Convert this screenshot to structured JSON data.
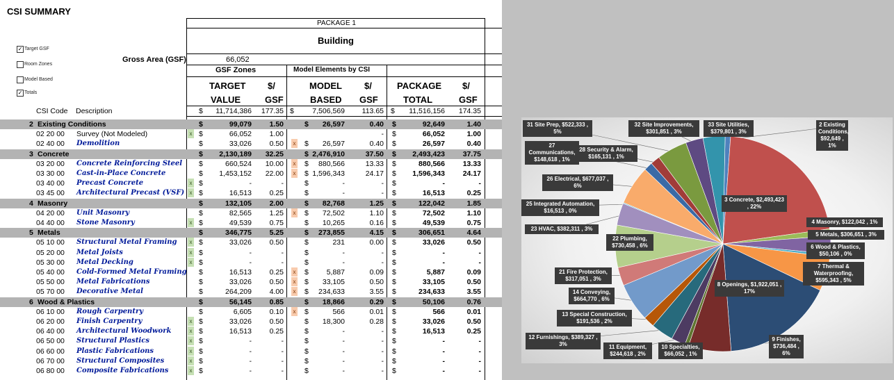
{
  "title": "CSI SUMMARY",
  "checkboxes": [
    {
      "label": "Target GSF",
      "checked": true
    },
    {
      "label": "Room Zones",
      "checked": false
    },
    {
      "label": "Model Based",
      "checked": false
    },
    {
      "label": "Totals",
      "checked": true
    }
  ],
  "package_label": "PACKAGE 1",
  "building_label": "Building",
  "gross_area_label": "Gross Area (GSF)",
  "gross_area_value": "66,052",
  "group_headers": {
    "gsf_zones": "GSF Zones",
    "model_elements": "Model Elements by CSI"
  },
  "col_headers": {
    "target_1": "TARGET",
    "target_2": "VALUE",
    "psf_1": "$/",
    "psf_2": "GSF",
    "model_1": "MODEL",
    "model_2": "BASED",
    "package_1": "PACKAGE",
    "package_2": "TOTAL"
  },
  "code_header": "CSI Code",
  "desc_header": "Description",
  "totals": {
    "dollar": "$",
    "target": "11,714,386",
    "target_psf": "177.35",
    "model": "7,506,569",
    "model_psf": "113.65",
    "package": "11,516,156",
    "package_psf": "174.35"
  },
  "rows": [
    {
      "type": "sec",
      "code": "2",
      "desc": "Existing Conditions",
      "d1": "$",
      "target": "99,079",
      "tpsf": "1.50",
      "d2": "$",
      "model": "26,597",
      "mpsf": "0.40",
      "d3": "$",
      "pkg": "92,649",
      "ppsf": "1.40"
    },
    {
      "type": "item",
      "code": "02 20 00",
      "desc": "Survey (Not Modeled)",
      "style": "plain",
      "g": "x",
      "o": "",
      "d1": "$",
      "target": "66,052",
      "tpsf": "1.00",
      "d2": "",
      "model": "",
      "mpsf": "-",
      "d3": "$",
      "pkg": "66,052",
      "ppsf": "1.00"
    },
    {
      "type": "item",
      "code": "02 40 00",
      "desc": "Demolition",
      "style": "blue",
      "g": "",
      "o": "x",
      "d1": "$",
      "target": "33,026",
      "tpsf": "0.50",
      "d2": "$",
      "model": "26,597",
      "mpsf": "0.40",
      "d3": "$",
      "pkg": "26,597",
      "ppsf": "0.40"
    },
    {
      "type": "sec",
      "code": "3",
      "desc": "Concrete",
      "d1": "$",
      "target": "2,130,189",
      "tpsf": "32.25",
      "d2": "$",
      "model": "2,476,910",
      "mpsf": "37.50",
      "d3": "$",
      "pkg": "2,493,423",
      "ppsf": "37.75"
    },
    {
      "type": "item",
      "code": "03 20 00",
      "desc": "Concrete Reinforcing Steel",
      "style": "blue",
      "g": "",
      "o": "x",
      "d1": "$",
      "target": "660,524",
      "tpsf": "10.00",
      "d2": "$",
      "model": "880,566",
      "mpsf": "13.33",
      "d3": "$",
      "pkg": "880,566",
      "ppsf": "13.33"
    },
    {
      "type": "item",
      "code": "03 30 00",
      "desc": "Cast-in-Place Concrete",
      "style": "blue",
      "g": "",
      "o": "x",
      "d1": "$",
      "target": "1,453,152",
      "tpsf": "22.00",
      "d2": "$",
      "model": "1,596,343",
      "mpsf": "24.17",
      "d3": "$",
      "pkg": "1,596,343",
      "ppsf": "24.17"
    },
    {
      "type": "item",
      "code": "03 40 00",
      "desc": "Precast Concrete",
      "style": "blue",
      "g": "x",
      "o": "",
      "d1": "$",
      "target": "-",
      "tpsf": "-",
      "d2": "$",
      "model": "-",
      "mpsf": "-",
      "d3": "$",
      "pkg": "-",
      "ppsf": "-"
    },
    {
      "type": "item",
      "code": "03 45 00",
      "desc": "Architectural Precast (VSF)",
      "style": "blue",
      "g": "x",
      "o": "",
      "d1": "$",
      "target": "16,513",
      "tpsf": "0.25",
      "d2": "$",
      "model": "-",
      "mpsf": "-",
      "d3": "$",
      "pkg": "16,513",
      "ppsf": "0.25"
    },
    {
      "type": "sec",
      "code": "4",
      "desc": "Masonry",
      "d1": "$",
      "target": "132,105",
      "tpsf": "2.00",
      "d2": "$",
      "model": "82,768",
      "mpsf": "1.25",
      "d3": "$",
      "pkg": "122,042",
      "ppsf": "1.85"
    },
    {
      "type": "item",
      "code": "04 20 00",
      "desc": "Unit Masonry",
      "style": "blue",
      "g": "",
      "o": "x",
      "d1": "$",
      "target": "82,565",
      "tpsf": "1.25",
      "d2": "$",
      "model": "72,502",
      "mpsf": "1.10",
      "d3": "$",
      "pkg": "72,502",
      "ppsf": "1.10"
    },
    {
      "type": "item",
      "code": "04 40 00",
      "desc": "Stone Masonry",
      "style": "blue",
      "g": "x",
      "o": "",
      "d1": "$",
      "target": "49,539",
      "tpsf": "0.75",
      "d2": "$",
      "model": "10,265",
      "mpsf": "0.16",
      "d3": "$",
      "pkg": "49,539",
      "ppsf": "0.75"
    },
    {
      "type": "sec",
      "code": "5",
      "desc": "Metals",
      "d1": "$",
      "target": "346,775",
      "tpsf": "5.25",
      "d2": "$",
      "model": "273,855",
      "mpsf": "4.15",
      "d3": "$",
      "pkg": "306,651",
      "ppsf": "4.64"
    },
    {
      "type": "item",
      "code": "05 10 00",
      "desc": "Structural Metal Framing",
      "style": "blue",
      "g": "x",
      "o": "",
      "d1": "$",
      "target": "33,026",
      "tpsf": "0.50",
      "d2": "$",
      "model": "231",
      "mpsf": "0.00",
      "d3": "$",
      "pkg": "33,026",
      "ppsf": "0.50"
    },
    {
      "type": "item",
      "code": "05 20 00",
      "desc": "Metal Joists",
      "style": "blue",
      "g": "x",
      "o": "",
      "d1": "$",
      "target": "-",
      "tpsf": "-",
      "d2": "$",
      "model": "-",
      "mpsf": "-",
      "d3": "$",
      "pkg": "-",
      "ppsf": "-"
    },
    {
      "type": "item",
      "code": "05 30 00",
      "desc": "Metal Decking",
      "style": "blue",
      "g": "x",
      "o": "",
      "d1": "$",
      "target": "-",
      "tpsf": "-",
      "d2": "$",
      "model": "-",
      "mpsf": "-",
      "d3": "$",
      "pkg": "-",
      "ppsf": "-"
    },
    {
      "type": "item",
      "code": "05 40 00",
      "desc": "Cold-Formed Metal Framing",
      "style": "blue",
      "g": "",
      "o": "x",
      "d1": "$",
      "target": "16,513",
      "tpsf": "0.25",
      "d2": "$",
      "model": "5,887",
      "mpsf": "0.09",
      "d3": "$",
      "pkg": "5,887",
      "ppsf": "0.09"
    },
    {
      "type": "item",
      "code": "05 50 00",
      "desc": "Metal Fabrications",
      "style": "blue",
      "g": "",
      "o": "x",
      "d1": "$",
      "target": "33,026",
      "tpsf": "0.50",
      "d2": "$",
      "model": "33,105",
      "mpsf": "0.50",
      "d3": "$",
      "pkg": "33,105",
      "ppsf": "0.50"
    },
    {
      "type": "item",
      "code": "05 70 00",
      "desc": "Decorative Metal",
      "style": "blue",
      "g": "",
      "o": "x",
      "d1": "$",
      "target": "264,209",
      "tpsf": "4.00",
      "d2": "$",
      "model": "234,633",
      "mpsf": "3.55",
      "d3": "$",
      "pkg": "234,633",
      "ppsf": "3.55"
    },
    {
      "type": "sec",
      "code": "6",
      "desc": "Wood & Plastics",
      "d1": "$",
      "target": "56,145",
      "tpsf": "0.85",
      "d2": "$",
      "model": "18,866",
      "mpsf": "0.29",
      "d3": "$",
      "pkg": "50,106",
      "ppsf": "0.76"
    },
    {
      "type": "item",
      "code": "06 10 00",
      "desc": "Rough Carpentry",
      "style": "blue",
      "g": "",
      "o": "x",
      "d1": "$",
      "target": "6,605",
      "tpsf": "0.10",
      "d2": "$",
      "model": "566",
      "mpsf": "0.01",
      "d3": "$",
      "pkg": "566",
      "ppsf": "0.01"
    },
    {
      "type": "item",
      "code": "06 20 00",
      "desc": "Finish Carpentry",
      "style": "blue",
      "g": "x",
      "o": "",
      "d1": "$",
      "target": "33,026",
      "tpsf": "0.50",
      "d2": "$",
      "model": "18,300",
      "mpsf": "0.28",
      "d3": "$",
      "pkg": "33,026",
      "ppsf": "0.50"
    },
    {
      "type": "item",
      "code": "06 40 00",
      "desc": "Architectural Woodwork",
      "style": "blue",
      "g": "x",
      "o": "",
      "d1": "$",
      "target": "16,513",
      "tpsf": "0.25",
      "d2": "$",
      "model": "-",
      "mpsf": "-",
      "d3": "$",
      "pkg": "16,513",
      "ppsf": "0.25"
    },
    {
      "type": "item",
      "code": "06 50 00",
      "desc": "Structural Plastics",
      "style": "blue",
      "g": "x",
      "o": "",
      "d1": "$",
      "target": "-",
      "tpsf": "-",
      "d2": "$",
      "model": "-",
      "mpsf": "-",
      "d3": "$",
      "pkg": "-",
      "ppsf": "-"
    },
    {
      "type": "item",
      "code": "06 60 00",
      "desc": "Plastic Fabrications",
      "style": "blue",
      "g": "x",
      "o": "",
      "d1": "$",
      "target": "-",
      "tpsf": "-",
      "d2": "$",
      "model": "-",
      "mpsf": "-",
      "d3": "$",
      "pkg": "-",
      "ppsf": "-"
    },
    {
      "type": "item",
      "code": "06 70 00",
      "desc": "Structural Composites",
      "style": "blue",
      "g": "x",
      "o": "",
      "d1": "$",
      "target": "-",
      "tpsf": "-",
      "d2": "$",
      "model": "-",
      "mpsf": "-",
      "d3": "$",
      "pkg": "-",
      "ppsf": "-"
    },
    {
      "type": "item",
      "code": "06 80 00",
      "desc": "Composite Fabrications",
      "style": "blue",
      "g": "x",
      "o": "",
      "d1": "$",
      "target": "-",
      "tpsf": "-",
      "d2": "$",
      "model": "-",
      "mpsf": "-",
      "d3": "$",
      "pkg": "-",
      "ppsf": "-"
    }
  ],
  "chart_data": {
    "type": "pie",
    "slices": [
      {
        "label": "2 Existing Conditions, $92,649 , 1%",
        "value": 92649,
        "color": "#4f81bd"
      },
      {
        "label": "3 Concrete, $2,493,423 , 22%",
        "value": 2493423,
        "color": "#c0504d"
      },
      {
        "label": "4 Masonry, $122,042 , 1%",
        "value": 122042,
        "color": "#9bbb59"
      },
      {
        "label": "5 Metals, $306,651 , 3%",
        "value": 306651,
        "color": "#8064a2"
      },
      {
        "label": "6 Wood & Plastics, $50,106 , 0%",
        "value": 50106,
        "color": "#4bacc6"
      },
      {
        "label": "7 Thermal & Waterproofing, $595,343 , 5%",
        "value": 595343,
        "color": "#f79646"
      },
      {
        "label": "8 Openings, $1,922,051 , 17%",
        "value": 1922051,
        "color": "#2c4d75"
      },
      {
        "label": "9 Finishes, $736,484 , 6%",
        "value": 736484,
        "color": "#772c2a"
      },
      {
        "label": "10 Specialties, $66,052 , 1%",
        "value": 66052,
        "color": "#5f7530"
      },
      {
        "label": "11 Equipment, $244,618 , 2%",
        "value": 244618,
        "color": "#4d3b62"
      },
      {
        "label": "12 Furnishings, $389,327 , 3%",
        "value": 389327,
        "color": "#276a7c"
      },
      {
        "label": "13 Special Construction, $191,536 , 2%",
        "value": 191536,
        "color": "#b65708"
      },
      {
        "label": "14 Conveying, $664,770 , 6%",
        "value": 664770,
        "color": "#729aca"
      },
      {
        "label": "21 Fire Protection, $317,051 , 3%",
        "value": 317051,
        "color": "#d07a78"
      },
      {
        "label": "22 Plumbing, $730,458 , 6%",
        "value": 730458,
        "color": "#b5cf8c"
      },
      {
        "label": "23 HVAC, $382,311 , 3%",
        "value": 382311,
        "color": "#a18fbe"
      },
      {
        "label": "25 Integrated Automation, $16,513 , 0%",
        "value": 16513,
        "color": "#6fbed6"
      },
      {
        "label": "26 Electrical, $677,037 , 6%",
        "value": 677037,
        "color": "#f9ab6b"
      },
      {
        "label": "27 Communications, $148,618 , 1%",
        "value": 148618,
        "color": "#3a6aa6"
      },
      {
        "label": "28 Security & Alarm, $165,131 , 1%",
        "value": 165131,
        "color": "#a13c39"
      },
      {
        "label": "31 Site Prep, $522,333 , 5%",
        "value": 522333,
        "color": "#7a9a3f"
      },
      {
        "label": "32 Site Improvements, $301,851 , 3%",
        "value": 301851,
        "color": "#5e4a82"
      },
      {
        "label": "33 Site Utilities, $379,801 , 3%",
        "value": 379801,
        "color": "#3394ac"
      }
    ]
  }
}
